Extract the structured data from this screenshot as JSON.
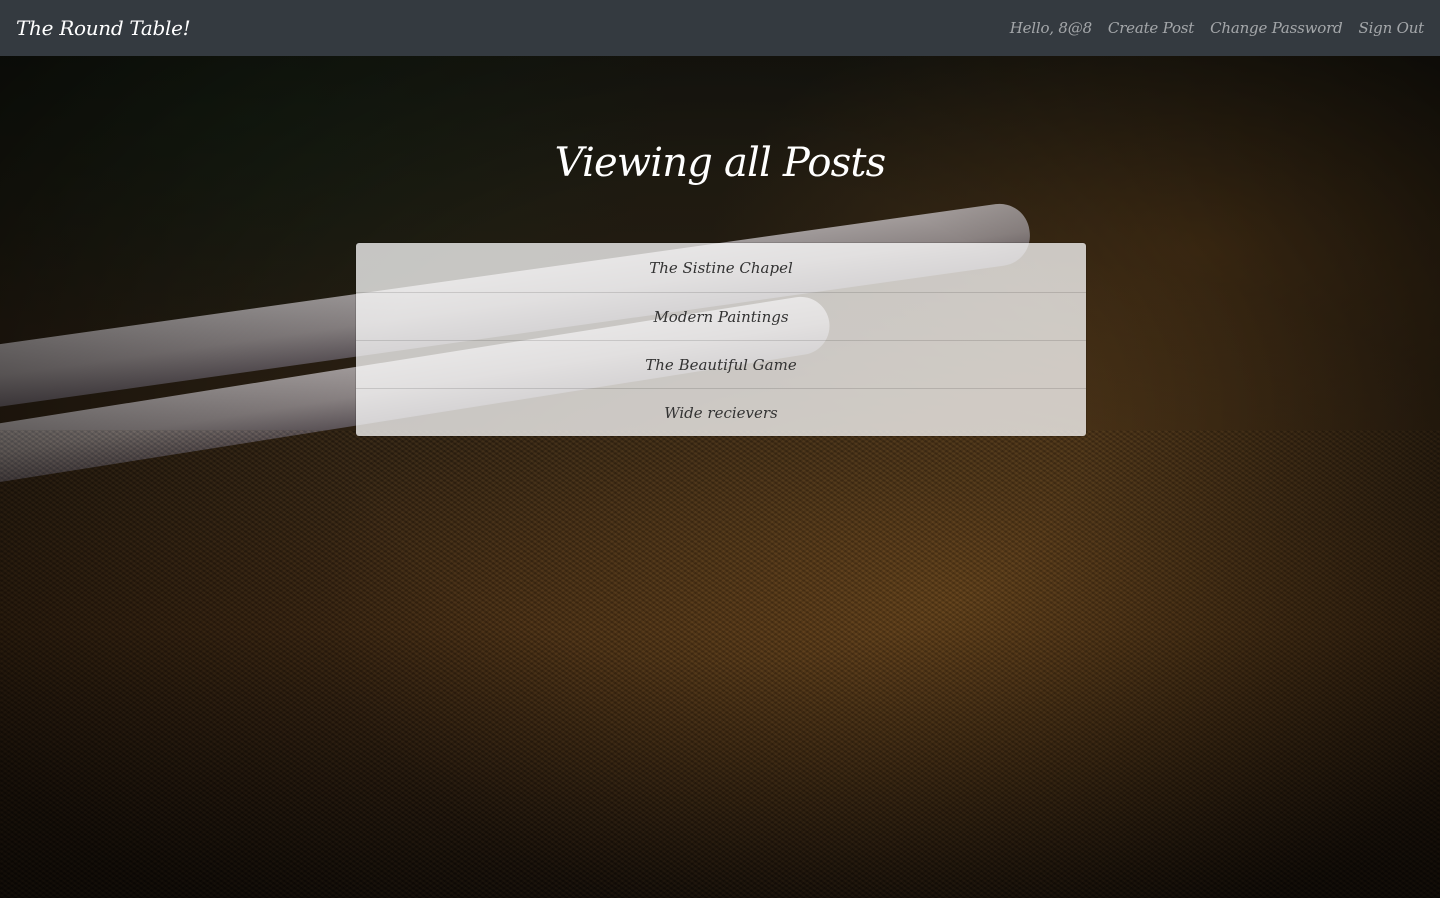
{
  "navbar": {
    "brand": "The Round Table!",
    "greeting": "Hello, 8@8",
    "links": [
      "Create Post",
      "Change Password",
      "Sign Out"
    ]
  },
  "main": {
    "title": "Viewing all Posts",
    "posts": [
      "The Sistine Chapel",
      "Modern Paintings",
      "The Beautiful Game",
      "Wide recievers"
    ]
  },
  "colors": {
    "navbar_bg": "#343a40",
    "navbar_link": "rgba(255,255,255,0.55)",
    "title_text": "#ffffff",
    "post_text": "#333333"
  }
}
